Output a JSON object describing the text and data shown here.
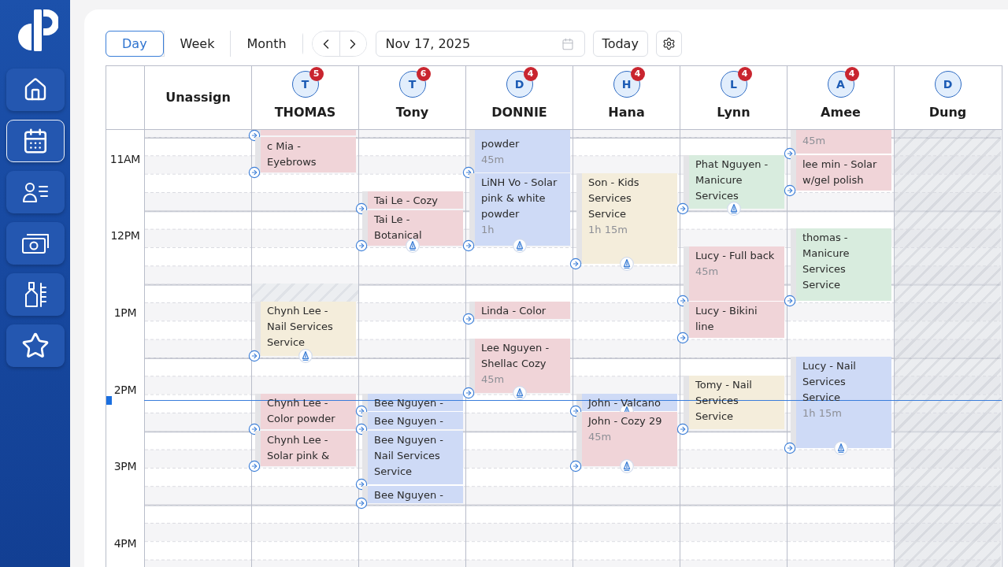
{
  "sidebar": {
    "items": [
      {
        "kind": "home",
        "selected": false
      },
      {
        "kind": "calendar",
        "selected": true
      },
      {
        "kind": "contacts",
        "selected": false
      },
      {
        "kind": "money",
        "selected": false
      },
      {
        "kind": "polish",
        "selected": false
      },
      {
        "kind": "star",
        "selected": false
      }
    ]
  },
  "toolbar": {
    "views": [
      {
        "label": "Day",
        "selected": true
      },
      {
        "label": "Week",
        "selected": false
      },
      {
        "label": "Month",
        "selected": false
      }
    ],
    "date": "Nov 17, 2025",
    "today_button": "Today"
  },
  "calendar": {
    "hours": [
      "11AM",
      "12PM",
      "1PM",
      "2PM",
      "3PM",
      "4PM"
    ],
    "columns": [
      {
        "kind": "unassigned",
        "name": "Unassign"
      },
      {
        "kind": "staff",
        "name": "THOMAS",
        "initial": "T",
        "badge": "5",
        "off": false,
        "events": [
          {
            "kind": "appointment",
            "color": "#f0d4d8",
            "nib": false
          },
          {
            "kind": "appointment",
            "title": "c Mia - Eyebrows",
            "color": "#f0d4d8",
            "nib": false
          },
          {
            "kind": "blocked"
          },
          {
            "kind": "appointment",
            "title": "Chynh Lee - Nail Services Service",
            "color": "#f4eddb",
            "nib": true
          },
          {
            "kind": "appointment",
            "title": "Chynh Lee - Color powder",
            "color": "#f0d4d8",
            "nib": false
          },
          {
            "kind": "appointment",
            "title": "Chynh Lee - Solar pink &",
            "color": "#f0d4d8",
            "nib": false
          }
        ]
      },
      {
        "kind": "staff",
        "name": "Tony",
        "initial": "T",
        "badge": "6",
        "off": false,
        "events": [
          {
            "kind": "appointment",
            "title": "Tai Le - Cozy",
            "color": "#f0d4d8",
            "nib": false
          },
          {
            "kind": "appointment",
            "title": "Tai Le - Botanical",
            "color": "#f0d4d8",
            "nib": true
          },
          {
            "kind": "appointment",
            "title": "Bee Nguyen -",
            "color": "#cedaf6",
            "nib": false
          },
          {
            "kind": "appointment",
            "title": "Bee Nguyen -",
            "color": "#cedaf6",
            "nib": false
          },
          {
            "kind": "appointment",
            "title": "Bee Nguyen - Nail Services Service",
            "color": "#cedaf6",
            "nib": false
          },
          {
            "kind": "appointment",
            "title": "Bee Nguyen -",
            "color": "#cedaf6",
            "nib": false
          }
        ]
      },
      {
        "kind": "staff",
        "name": "DONNIE",
        "initial": "D",
        "badge": "4",
        "off": false,
        "events": [
          {
            "kind": "appointment",
            "title": "powder",
            "duration": "45m",
            "color": "#cedaf6",
            "nib": false
          },
          {
            "kind": "appointment",
            "title": "LiNH Vo - Solar pink & white powder",
            "duration": "1h",
            "color": "#cedaf6",
            "nib": true
          },
          {
            "kind": "appointment",
            "title": "Linda - Color",
            "color": "#f0d4d8",
            "nib": false
          },
          {
            "kind": "appointment",
            "title": "Lee Nguyen - Shellac Cozy",
            "duration": "45m",
            "color": "#f0d4d8",
            "nib": true
          }
        ]
      },
      {
        "kind": "staff",
        "name": "Hana",
        "initial": "H",
        "badge": "4",
        "off": false,
        "events": [
          {
            "kind": "appointment",
            "title": "Son - Kids Services Service",
            "duration": "1h 15m",
            "color": "#f4eddb",
            "nib": true
          },
          {
            "kind": "appointment",
            "title": "John - Valcano",
            "color": "#cedaf6",
            "nib": true
          },
          {
            "kind": "appointment",
            "title": "John - Cozy 29",
            "duration": "45m",
            "color": "#f0d4d8",
            "nib": true
          }
        ]
      },
      {
        "kind": "staff",
        "name": "Lynn",
        "initial": "L",
        "badge": "4",
        "off": false,
        "events": [
          {
            "kind": "appointment",
            "title": "Phat Nguyen - Manicure Services",
            "color": "#d8ecde",
            "nib": true
          },
          {
            "kind": "appointment",
            "title": "Lucy - Full back",
            "duration": "45m",
            "color": "#f0d4d8",
            "nib": false
          },
          {
            "kind": "appointment",
            "title": "Lucy - Bikini line",
            "color": "#f0d4d8",
            "nib": false
          },
          {
            "kind": "appointment",
            "title": "Tomy - Nail Services Service",
            "color": "#f4eddb",
            "nib": false
          }
        ]
      },
      {
        "kind": "staff",
        "name": "Amee",
        "initial": "A",
        "badge": "4",
        "off": false,
        "events": [
          {
            "kind": "appointment",
            "duration": "45m",
            "color": "#f0d4d8",
            "nib": false
          },
          {
            "kind": "appointment",
            "title": "lee min - Solar w/gel polish",
            "color": "#f0d4d8",
            "nib": false
          },
          {
            "kind": "appointment",
            "title": "thomas - Manicure Services Service",
            "color": "#d8ecde",
            "nib": false
          },
          {
            "kind": "appointment",
            "title": "Lucy - Nail Services Service",
            "duration": "1h 15m",
            "color": "#cedaf6",
            "nib": true
          }
        ]
      },
      {
        "kind": "staff",
        "name": "Dung",
        "initial": "D",
        "off": true
      }
    ]
  }
}
